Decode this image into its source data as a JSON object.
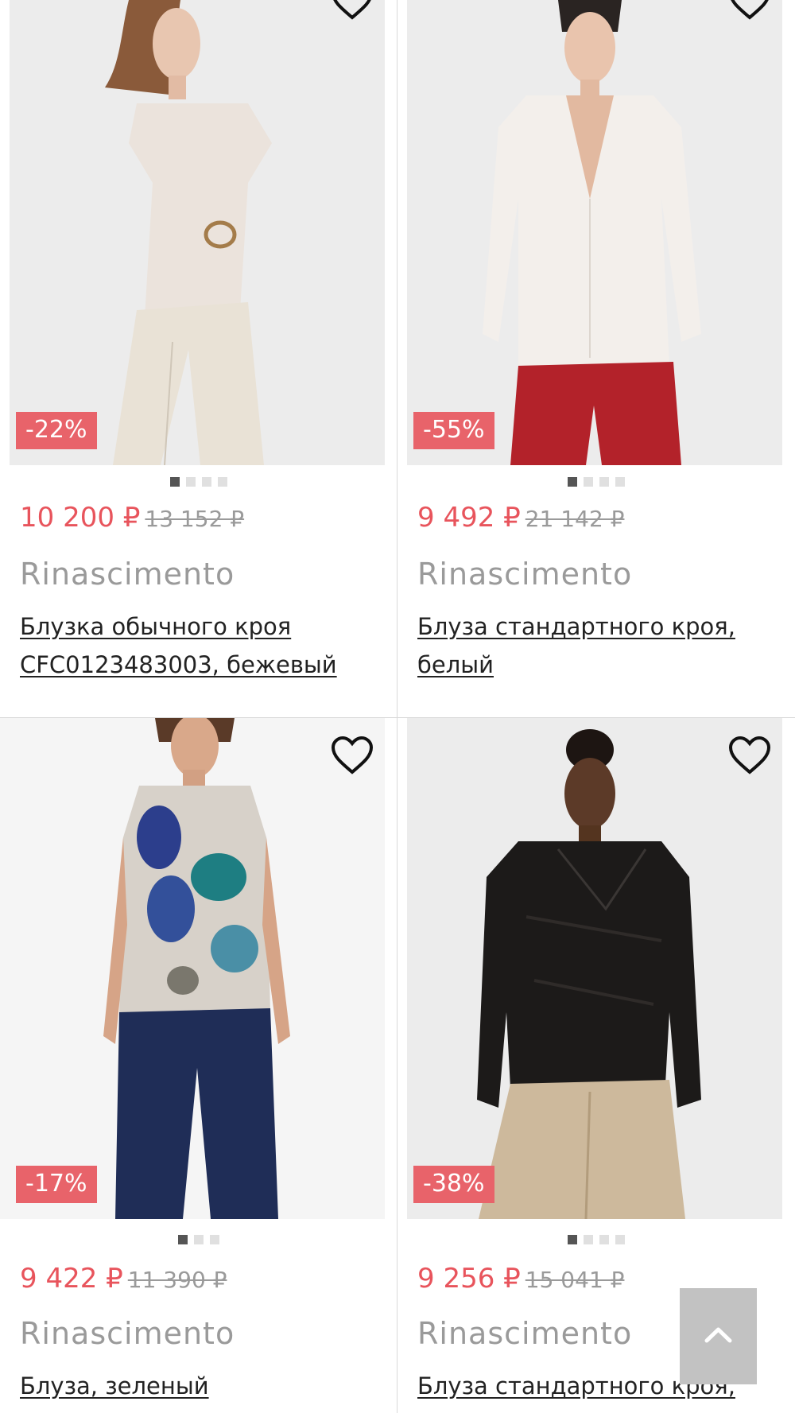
{
  "products": [
    {
      "discount": "-22%",
      "price": "10 200 ₽",
      "old_price": "13 152 ₽",
      "brand": "Rinascimento",
      "title": "Блузка обычного кроя CFC0123483003, бежевый",
      "image_dots": 4,
      "active_dot": 0
    },
    {
      "discount": "-55%",
      "price": "9 492 ₽",
      "old_price": "21 142 ₽",
      "brand": "Rinascimento",
      "title": "Блуза стандартного кроя, белый",
      "image_dots": 4,
      "active_dot": 0
    },
    {
      "discount": "-17%",
      "price": "9 422 ₽",
      "old_price": "11 390 ₽",
      "brand": "Rinascimento",
      "title": "Блуза, зеленый",
      "image_dots": 3,
      "active_dot": 0
    },
    {
      "discount": "-38%",
      "price": "9 256 ₽",
      "old_price": "15 041 ₽",
      "brand": "Rinascimento",
      "title": "Блуза стандартного кроя,",
      "image_dots": 4,
      "active_dot": 0
    }
  ],
  "icons": {
    "favorite": "heart-outline-icon",
    "scroll_top": "chevron-up-icon"
  },
  "colors": {
    "price": "#e8545c",
    "discount_badge": "#e8636a",
    "brand_text": "#9a9a9a",
    "scroll_top_button": "#c2c2c2"
  }
}
